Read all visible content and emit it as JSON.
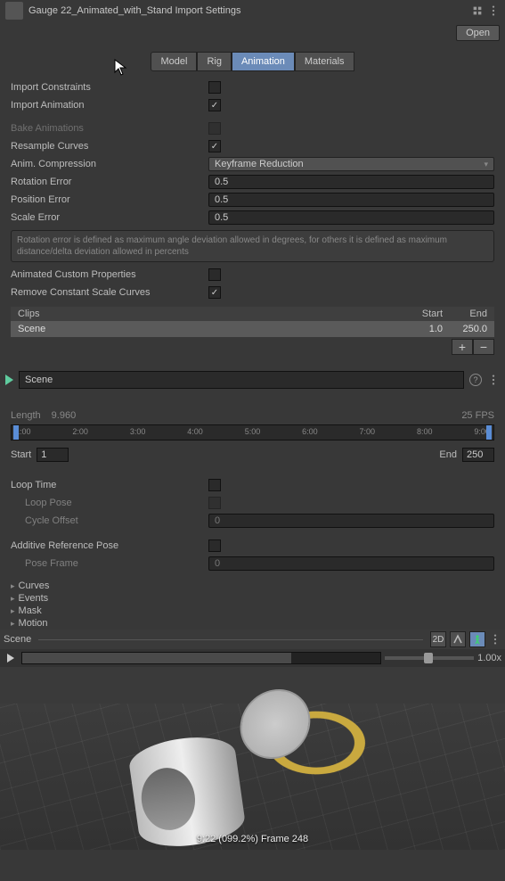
{
  "header": {
    "title": "Gauge 22_Animated_with_Stand Import Settings",
    "open": "Open"
  },
  "tabs": {
    "model": "Model",
    "rig": "Rig",
    "animation": "Animation",
    "materials": "Materials"
  },
  "fields": {
    "import_constraints": "Import Constraints",
    "import_animation": "Import Animation",
    "bake_animations": "Bake Animations",
    "resample_curves": "Resample Curves",
    "anim_compression": "Anim. Compression",
    "anim_compression_value": "Keyframe Reduction",
    "rotation_error": "Rotation Error",
    "rotation_error_value": "0.5",
    "position_error": "Position Error",
    "position_error_value": "0.5",
    "scale_error": "Scale Error",
    "scale_error_value": "0.5",
    "help": "Rotation error is defined as maximum angle deviation allowed in degrees, for others it is defined as maximum distance/delta deviation allowed in percents",
    "animated_custom_props": "Animated Custom Properties",
    "remove_constant_scale": "Remove Constant Scale Curves"
  },
  "clips": {
    "header_name": "Clips",
    "header_start": "Start",
    "header_end": "End",
    "row_name": "Scene",
    "row_start": "1.0",
    "row_end": "250.0",
    "plus": "+",
    "minus": "−"
  },
  "scene": {
    "name": "Scene",
    "length_label": "Length",
    "length_value": "9.960",
    "fps": "25 FPS",
    "start_label": "Start",
    "start_value": "1",
    "end_label": "End",
    "end_value": "250",
    "ticks": [
      "1:00",
      "2:00",
      "3:00",
      "4:00",
      "5:00",
      "6:00",
      "7:00",
      "8:00",
      "9:00"
    ]
  },
  "loop": {
    "loop_time": "Loop Time",
    "loop_pose": "Loop Pose",
    "cycle_offset": "Cycle Offset",
    "cycle_offset_value": "0",
    "additive_ref": "Additive Reference Pose",
    "pose_frame": "Pose Frame",
    "pose_frame_value": "0"
  },
  "folds": {
    "curves": "Curves",
    "events": "Events",
    "mask": "Mask",
    "motion": "Motion"
  },
  "preview": {
    "title": "Scene",
    "btn2d": "2D",
    "speed": "1.00x",
    "status": "9:22 (099.2%) Frame 248"
  }
}
